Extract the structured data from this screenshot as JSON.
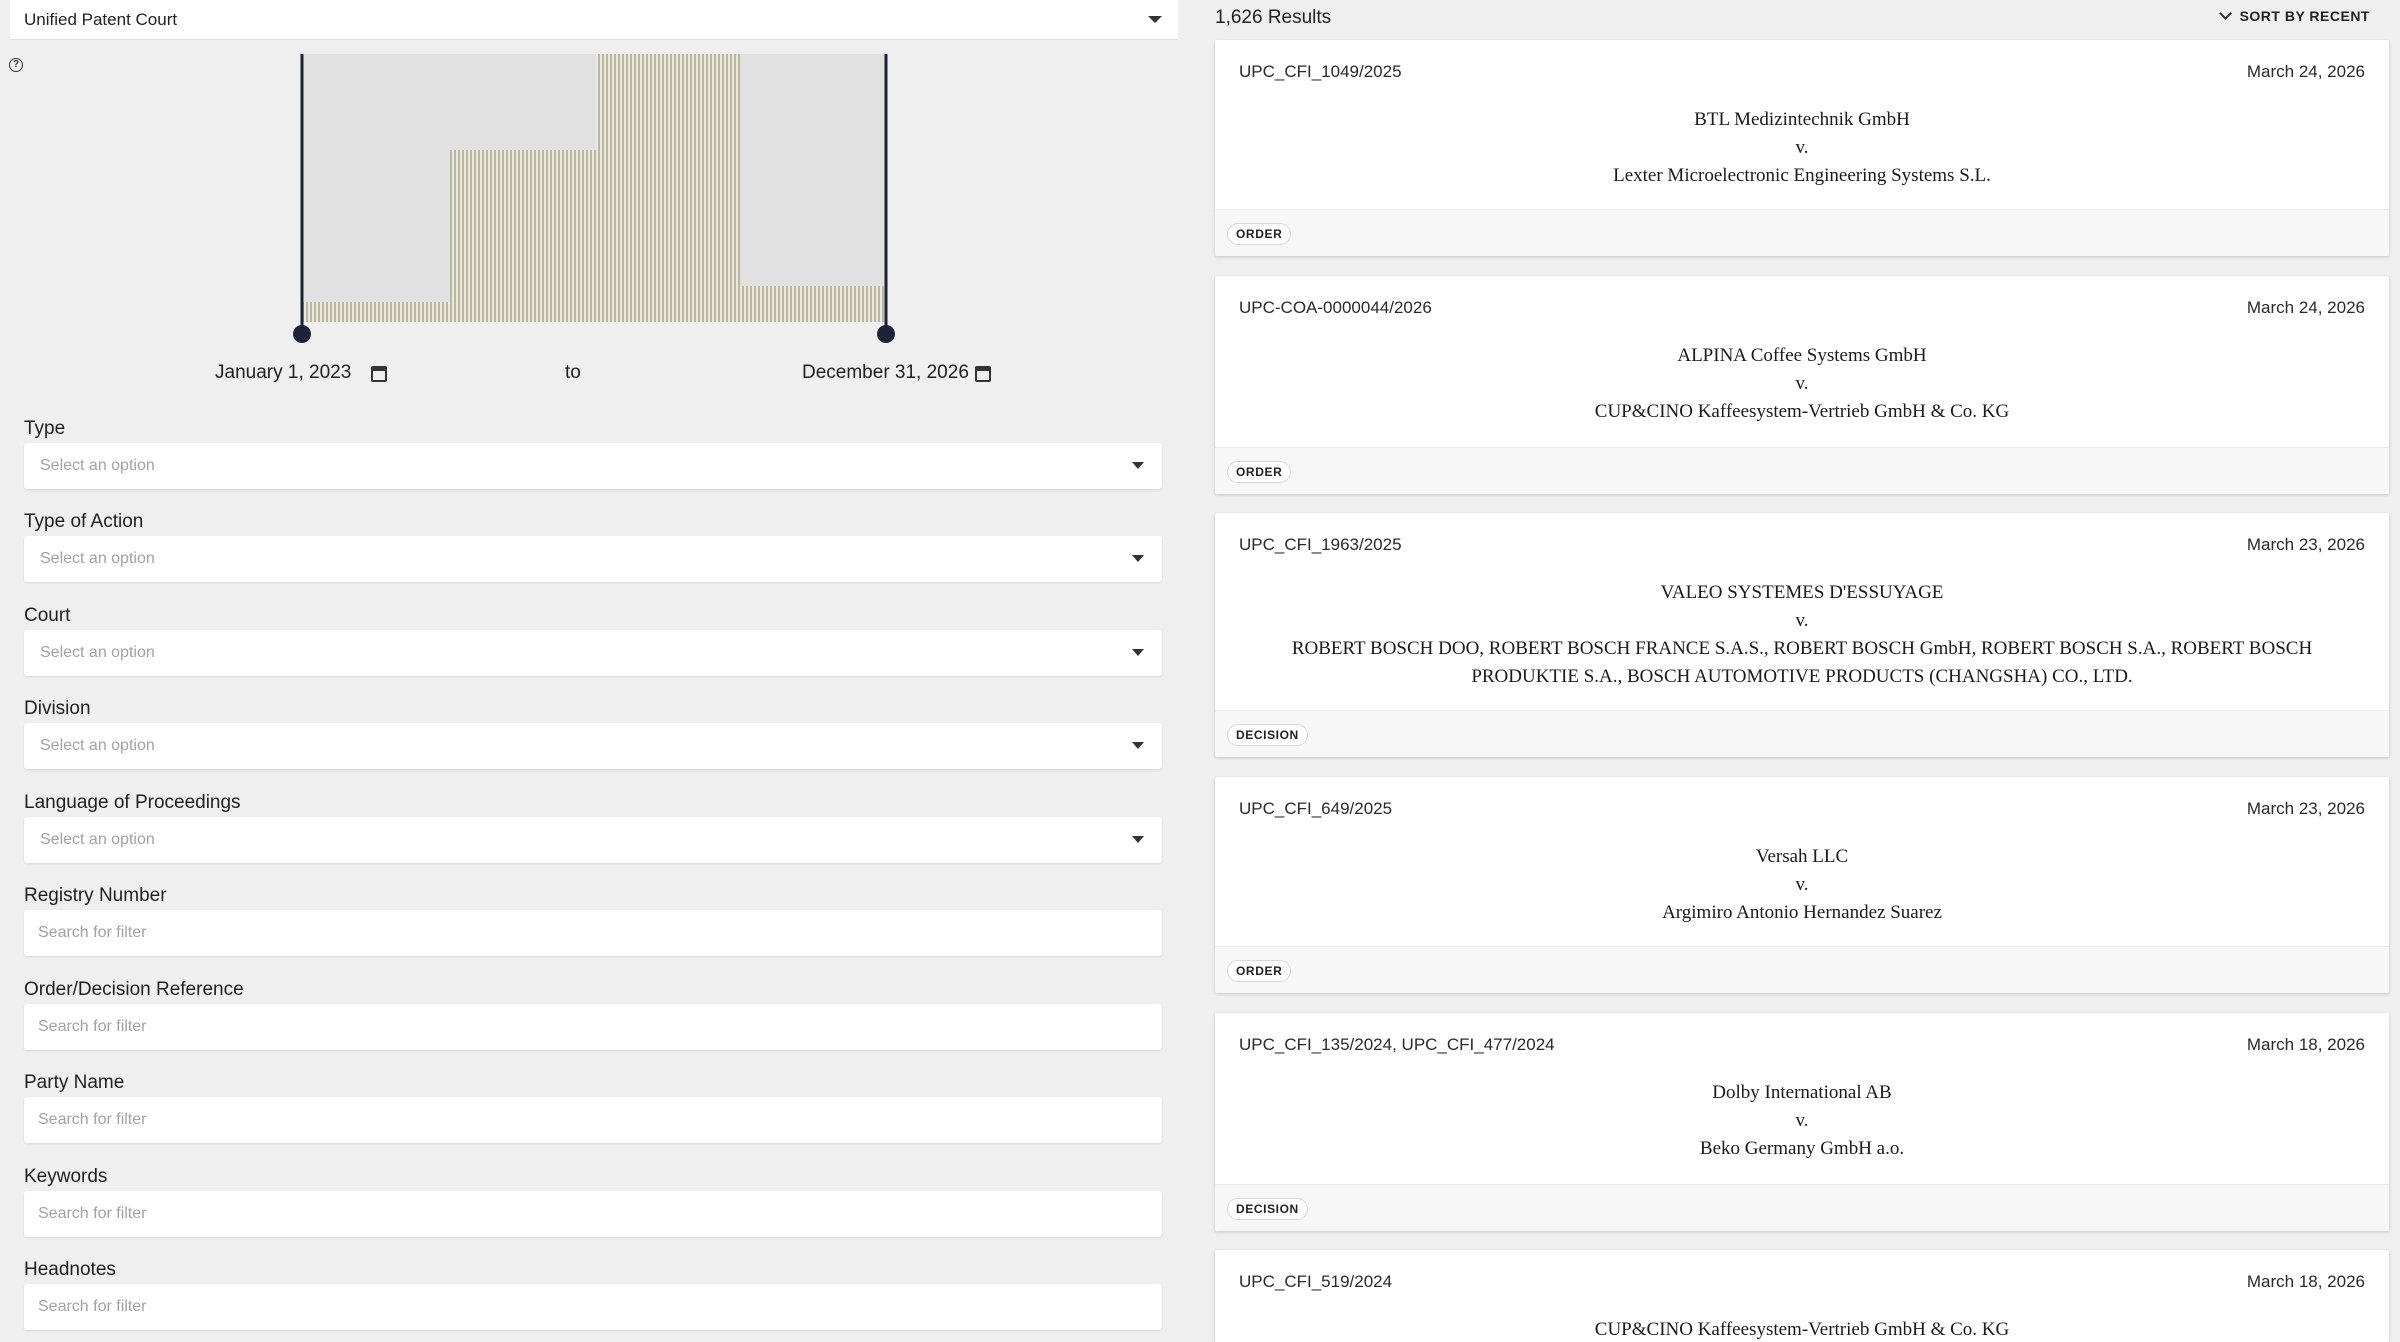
{
  "filters": {
    "court_select": "Unified Patent Court",
    "date_start": "January 1, 2023",
    "date_to": "to",
    "date_end": "December 31, 2026",
    "selects": [
      {
        "label": "Type",
        "placeholder": "Select an option"
      },
      {
        "label": "Type of Action",
        "placeholder": "Select an option"
      },
      {
        "label": "Court",
        "placeholder": "Select an option"
      },
      {
        "label": "Division",
        "placeholder": "Select an option"
      },
      {
        "label": "Language of Proceedings",
        "placeholder": "Select an option"
      }
    ],
    "texts": [
      {
        "label": "Registry Number",
        "placeholder": "Search for filter"
      },
      {
        "label": "Order/Decision Reference",
        "placeholder": "Search for filter"
      },
      {
        "label": "Party Name",
        "placeholder": "Search for filter"
      },
      {
        "label": "Keywords",
        "placeholder": "Search for filter"
      },
      {
        "label": "Headnotes",
        "placeholder": "Search for filter"
      }
    ]
  },
  "results": {
    "count": "1,626 Results",
    "sort_label": "SORT BY RECENT",
    "cards": [
      {
        "id": "UPC_CFI_1049/2025",
        "date": "March 24, 2026",
        "claimant": "BTL Medizintechnik GmbH",
        "vs": "v.",
        "defendant": "Lexter Microelectronic Engineering Systems S.L.",
        "badge": "ORDER"
      },
      {
        "id": "UPC-COA-0000044/2026",
        "date": "March 24, 2026",
        "claimant": "ALPINA Coffee Systems GmbH",
        "vs": "v.",
        "defendant": "CUP&CINO Kaffeesystem-Vertrieb GmbH & Co. KG",
        "badge": "ORDER"
      },
      {
        "id": "UPC_CFI_1963/2025",
        "date": "March 23, 2026",
        "claimant": "VALEO SYSTEMES D'ESSUYAGE",
        "vs": "v.",
        "defendant": "ROBERT BOSCH DOO, ROBERT BOSCH FRANCE S.A.S., ROBERT BOSCH GmbH, ROBERT BOSCH S.A., ROBERT BOSCH PRODUKTIE S.A., BOSCH AUTOMOTIVE PRODUCTS (CHANGSHA) CO., LTD.",
        "badge": "DECISION"
      },
      {
        "id": "UPC_CFI_649/2025",
        "date": "March 23, 2026",
        "claimant": "Versah LLC",
        "vs": "v.",
        "defendant": "Argimiro Antonio Hernandez Suarez",
        "badge": "ORDER"
      },
      {
        "id": "UPC_CFI_135/2024, UPC_CFI_477/2024",
        "date": "March 18, 2026",
        "claimant": "Dolby International AB",
        "vs": "v.",
        "defendant": "Beko Germany GmbH a.o.",
        "badge": "DECISION"
      },
      {
        "id": "UPC_CFI_519/2024",
        "date": "March 18, 2026",
        "claimant": "CUP&CINO Kaffeesystem-Vertrieb GmbH & Co. KG",
        "vs": "",
        "defendant": "",
        "badge": ""
      }
    ]
  }
}
